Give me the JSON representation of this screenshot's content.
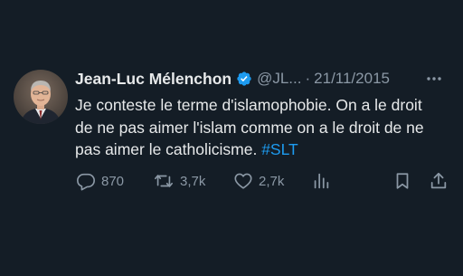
{
  "tweet": {
    "author_name": "Jean-Luc Mélenchon",
    "handle": "@JL...",
    "separator": "·",
    "date": "21/11/2015",
    "text_main": "Je conteste le terme d'islamophobie. On a le droit de ne pas aimer l'islam comme on a le droit de ne pas aimer le catholicisme. ",
    "hashtag": "#SLT"
  },
  "actions": {
    "reply_count": "870",
    "retweet_count": "3,7k",
    "like_count": "2,7k"
  },
  "colors": {
    "background": "#141d26",
    "text": "#e7e9ea",
    "secondary": "#8b98a5",
    "accent": "#1d9bf0"
  },
  "icons": [
    "verified-badge-icon",
    "more-icon",
    "reply-icon",
    "retweet-icon",
    "like-icon",
    "views-icon",
    "bookmark-icon",
    "share-icon"
  ]
}
